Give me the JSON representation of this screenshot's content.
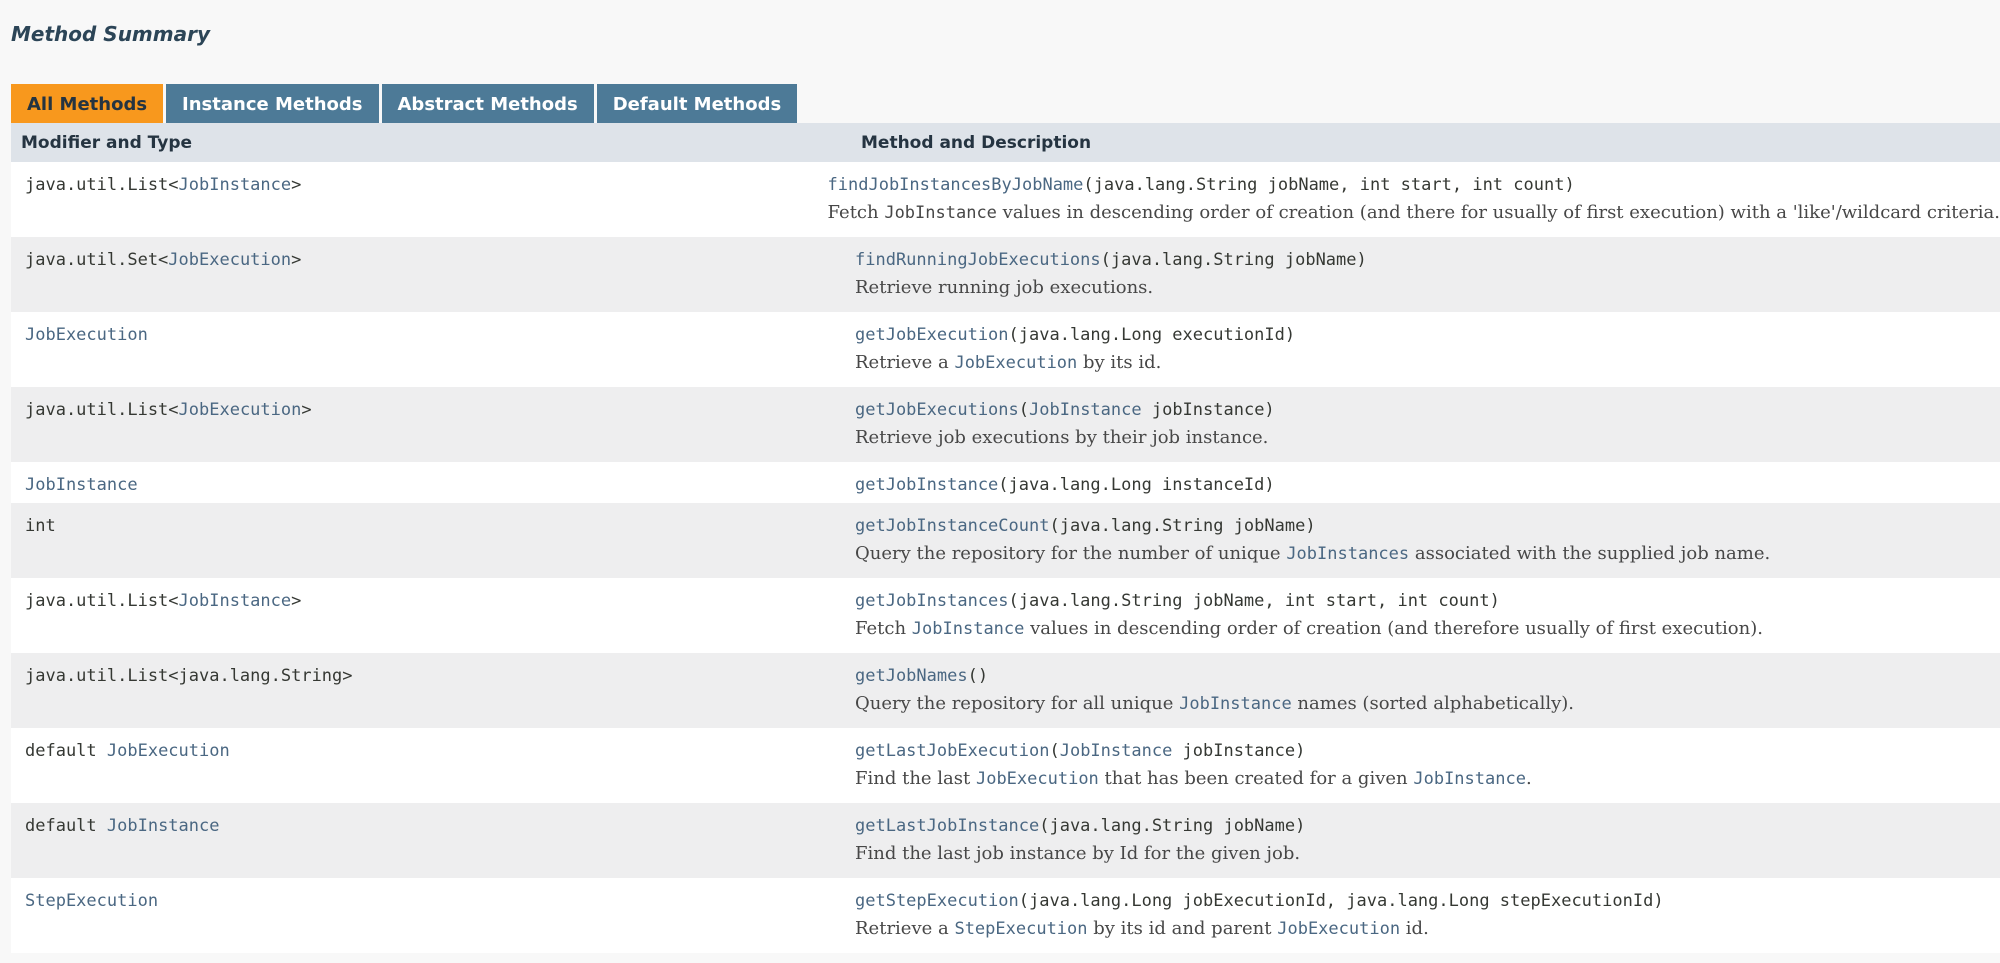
{
  "heading": "Method Summary",
  "tabs": [
    {
      "label": "All Methods",
      "active": true
    },
    {
      "label": "Instance Methods",
      "active": false
    },
    {
      "label": "Abstract Methods",
      "active": false
    },
    {
      "label": "Default Methods",
      "active": false
    }
  ],
  "columns": {
    "type": "Modifier and Type",
    "method": "Method and Description"
  },
  "colors": {
    "active_tab": "#f8981d",
    "inactive_tab": "#4d7a97",
    "header_row": "#dee3e9",
    "link": "#4a6782"
  },
  "rows": [
    {
      "type": [
        {
          "t": "java.util.List<"
        },
        {
          "t": "JobInstance",
          "link": true
        },
        {
          "t": ">"
        }
      ],
      "sig": [
        {
          "t": "findJobInstancesByJobName",
          "link": true
        },
        {
          "t": "(java.lang.String jobName, int start, int count)"
        }
      ],
      "desc": [
        {
          "t": "Fetch "
        },
        {
          "t": "JobInstance",
          "code": true
        },
        {
          "t": " values in descending order of creation (and there for usually of first execution) with a 'like'/wildcard criteria."
        }
      ]
    },
    {
      "type": [
        {
          "t": "java.util.Set<"
        },
        {
          "t": "JobExecution",
          "link": true
        },
        {
          "t": ">"
        }
      ],
      "sig": [
        {
          "t": "findRunningJobExecutions",
          "link": true
        },
        {
          "t": "(java.lang.String jobName)"
        }
      ],
      "desc": [
        {
          "t": "Retrieve running job executions."
        }
      ]
    },
    {
      "type": [
        {
          "t": "JobExecution",
          "link": true
        }
      ],
      "sig": [
        {
          "t": "getJobExecution",
          "link": true
        },
        {
          "t": "(java.lang.Long executionId)"
        }
      ],
      "desc": [
        {
          "t": "Retrieve a "
        },
        {
          "t": "JobExecution",
          "code": true,
          "link": true
        },
        {
          "t": " by its id."
        }
      ]
    },
    {
      "type": [
        {
          "t": "java.util.List<"
        },
        {
          "t": "JobExecution",
          "link": true
        },
        {
          "t": ">"
        }
      ],
      "sig": [
        {
          "t": "getJobExecutions",
          "link": true
        },
        {
          "t": "("
        },
        {
          "t": "JobInstance",
          "link": true
        },
        {
          "t": " jobInstance)"
        }
      ],
      "desc": [
        {
          "t": "Retrieve job executions by their job instance."
        }
      ]
    },
    {
      "type": [
        {
          "t": "JobInstance",
          "link": true
        }
      ],
      "sig": [
        {
          "t": "getJobInstance",
          "link": true
        },
        {
          "t": "(java.lang.Long instanceId)"
        }
      ],
      "desc": []
    },
    {
      "type": [
        {
          "t": "int"
        }
      ],
      "sig": [
        {
          "t": "getJobInstanceCount",
          "link": true
        },
        {
          "t": "(java.lang.String jobName)"
        }
      ],
      "desc": [
        {
          "t": "Query the repository for the number of unique "
        },
        {
          "t": "JobInstances",
          "code": true,
          "link": true
        },
        {
          "t": " associated with the supplied job name."
        }
      ]
    },
    {
      "type": [
        {
          "t": "java.util.List<"
        },
        {
          "t": "JobInstance",
          "link": true
        },
        {
          "t": ">"
        }
      ],
      "sig": [
        {
          "t": "getJobInstances",
          "link": true
        },
        {
          "t": "(java.lang.String jobName, int start, int count)"
        }
      ],
      "desc": [
        {
          "t": "Fetch "
        },
        {
          "t": "JobInstance",
          "code": true,
          "link": true
        },
        {
          "t": " values in descending order of creation (and therefore usually of first execution)."
        }
      ]
    },
    {
      "type": [
        {
          "t": "java.util.List<java.lang.String>"
        }
      ],
      "sig": [
        {
          "t": "getJobNames",
          "link": true
        },
        {
          "t": "()"
        }
      ],
      "desc": [
        {
          "t": "Query the repository for all unique "
        },
        {
          "t": "JobInstance",
          "code": true,
          "link": true
        },
        {
          "t": " names (sorted alphabetically)."
        }
      ]
    },
    {
      "type": [
        {
          "t": "default "
        },
        {
          "t": "JobExecution",
          "link": true
        }
      ],
      "sig": [
        {
          "t": "getLastJobExecution",
          "link": true
        },
        {
          "t": "("
        },
        {
          "t": "JobInstance",
          "link": true
        },
        {
          "t": " jobInstance)"
        }
      ],
      "desc": [
        {
          "t": "Find the last "
        },
        {
          "t": "JobExecution",
          "code": true,
          "link": true
        },
        {
          "t": " that has been created for a given "
        },
        {
          "t": "JobInstance",
          "code": true,
          "link": true
        },
        {
          "t": "."
        }
      ]
    },
    {
      "type": [
        {
          "t": "default "
        },
        {
          "t": "JobInstance",
          "link": true
        }
      ],
      "sig": [
        {
          "t": "getLastJobInstance",
          "link": true
        },
        {
          "t": "(java.lang.String jobName)"
        }
      ],
      "desc": [
        {
          "t": "Find the last job instance by Id for the given job."
        }
      ]
    },
    {
      "type": [
        {
          "t": "StepExecution",
          "link": true
        }
      ],
      "sig": [
        {
          "t": "getStepExecution",
          "link": true
        },
        {
          "t": "(java.lang.Long jobExecutionId, java.lang.Long stepExecutionId)"
        }
      ],
      "desc": [
        {
          "t": "Retrieve a "
        },
        {
          "t": "StepExecution",
          "code": true,
          "link": true
        },
        {
          "t": " by its id and parent "
        },
        {
          "t": "JobExecution",
          "code": true,
          "link": true
        },
        {
          "t": " id."
        }
      ]
    }
  ]
}
